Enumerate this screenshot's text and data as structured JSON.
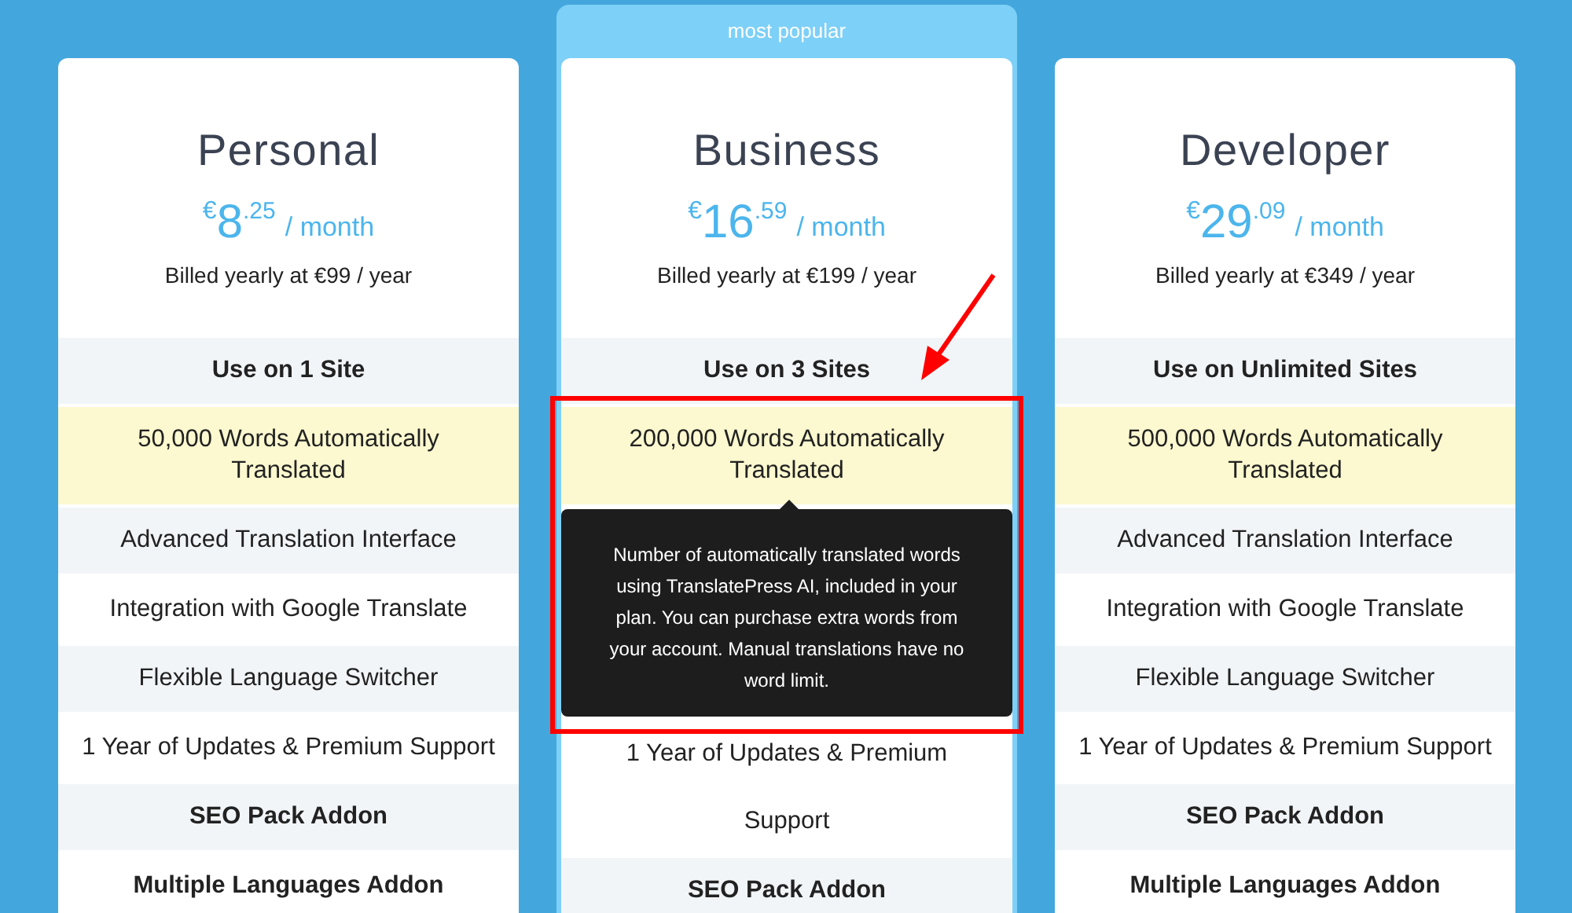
{
  "plans": [
    {
      "name": "Personal",
      "popular": false,
      "price": {
        "currency": "€",
        "whole": "8",
        "cents": ".25",
        "period": "/ month"
      },
      "billing": "Billed yearly at €99 / year",
      "features": [
        {
          "text": "Use on 1 Site",
          "kind": "bold",
          "shaded": true
        },
        {
          "text": "50,000 Words Automatically Translated",
          "kind": "highlight"
        },
        {
          "text": "Advanced Translation Interface",
          "kind": "plain",
          "shaded": true
        },
        {
          "text": "Integration with Google Translate",
          "kind": "plain",
          "shaded": false
        },
        {
          "text": "Flexible Language Switcher",
          "kind": "plain",
          "shaded": true
        },
        {
          "text": "1 Year of Updates & Premium Support",
          "kind": "plain",
          "shaded": false
        },
        {
          "text": "SEO Pack Addon",
          "kind": "bold",
          "shaded": true
        },
        {
          "text": "Multiple Languages Addon",
          "kind": "bold",
          "shaded": false
        }
      ]
    },
    {
      "name": "Business",
      "popular": true,
      "badge": "most popular",
      "price": {
        "currency": "€",
        "whole": "16",
        "cents": ".59",
        "period": "/ month"
      },
      "billing": "Billed yearly at €199 / year",
      "features": [
        {
          "text": "Use on 3 Sites",
          "kind": "bold",
          "shaded": true
        },
        {
          "text": "200,000 Words Automatically Translated",
          "kind": "highlight"
        },
        {
          "text": "1 Year of Updates & Premium Support",
          "kind": "plain",
          "shaded": false
        },
        {
          "text": "SEO Pack Addon",
          "kind": "bold",
          "shaded": true
        }
      ],
      "tooltip": "Number of automatically translated words using TranslatePress AI, included in your plan. You can purchase extra words from your account. Manual translations have no word limit."
    },
    {
      "name": "Developer",
      "popular": false,
      "price": {
        "currency": "€",
        "whole": "29",
        "cents": ".09",
        "period": "/ month"
      },
      "billing": "Billed yearly at €349 / year",
      "features": [
        {
          "text": "Use on Unlimited Sites",
          "kind": "bold",
          "shaded": true
        },
        {
          "text": "500,000 Words Automatically Translated",
          "kind": "highlight"
        },
        {
          "text": "Advanced Translation Interface",
          "kind": "plain",
          "shaded": true
        },
        {
          "text": "Integration with Google Translate",
          "kind": "plain",
          "shaded": false
        },
        {
          "text": "Flexible Language Switcher",
          "kind": "plain",
          "shaded": true
        },
        {
          "text": "1 Year of Updates & Premium Support",
          "kind": "plain",
          "shaded": false
        },
        {
          "text": "SEO Pack Addon",
          "kind": "bold",
          "shaded": true
        },
        {
          "text": "Multiple Languages Addon",
          "kind": "bold",
          "shaded": false
        }
      ]
    }
  ]
}
